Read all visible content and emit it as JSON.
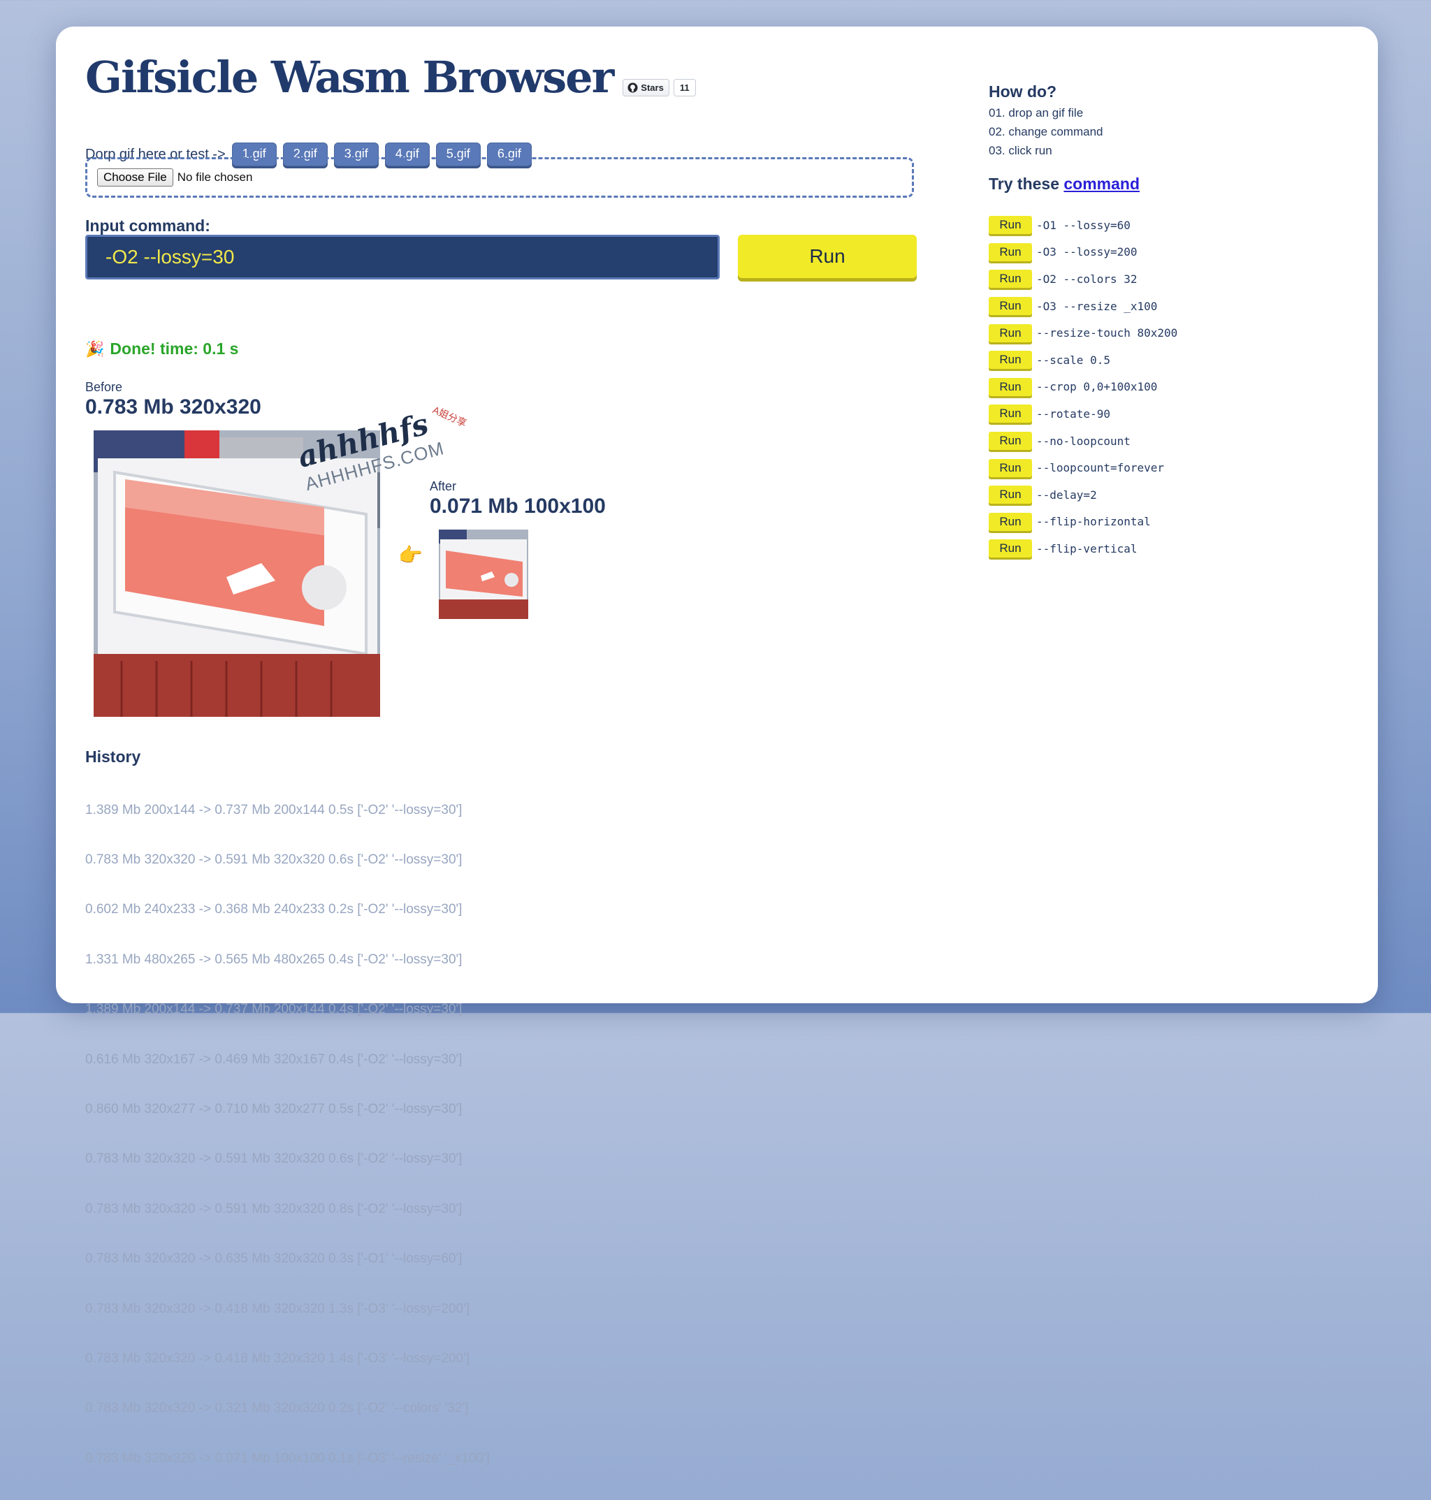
{
  "header": {
    "title": "Gifsicle Wasm Browser",
    "github_stars_label": "Stars",
    "github_stars_count": "11"
  },
  "drop": {
    "label": "Dorp gif here or test ->",
    "samples": [
      "1.gif",
      "2.gif",
      "3.gif",
      "4.gif",
      "5.gif",
      "6.gif"
    ],
    "choose_label": "Choose File",
    "file_status": "No file chosen"
  },
  "command": {
    "label": "Input command:",
    "value": "-O2 --lossy=30",
    "run_label": "Run"
  },
  "status": {
    "icon": "party-popper-icon",
    "text": "Done! time: 0.1 s"
  },
  "result": {
    "before_label": "Before",
    "before_value": "0.783 Mb 320x320",
    "after_label": "After",
    "after_value": "0.071 Mb 100x100",
    "arrow_icon": "pointing-hand-icon"
  },
  "watermark": {
    "main": "ahhhhfs",
    "sub": "AHHHHFS.COM",
    "tag": "A姐分享"
  },
  "history": {
    "title": "History",
    "items": [
      "1.389 Mb 200x144 -> 0.737 Mb 200x144 0.5s ['-O2' '--lossy=30']",
      "0.783 Mb 320x320 -> 0.591 Mb 320x320 0.6s ['-O2' '--lossy=30']",
      "0.602 Mb 240x233 -> 0.368 Mb 240x233 0.2s ['-O2' '--lossy=30']",
      "1.331 Mb 480x265 -> 0.565 Mb 480x265 0.4s ['-O2' '--lossy=30']",
      "1.389 Mb 200x144 -> 0.737 Mb 200x144 0.4s ['-O2' '--lossy=30']",
      "0.616 Mb 320x167 -> 0.469 Mb 320x167 0.4s ['-O2' '--lossy=30']",
      "0.860 Mb 320x277 -> 0.710 Mb 320x277 0.5s ['-O2' '--lossy=30']",
      "0.783 Mb 320x320 -> 0.591 Mb 320x320 0.6s ['-O2' '--lossy=30']",
      "0.783 Mb 320x320 -> 0.591 Mb 320x320 0.8s ['-O2' '--lossy=30']",
      "0.783 Mb 320x320 -> 0.635 Mb 320x320 0.3s ['-O1' '--lossy=60']",
      "0.783 Mb 320x320 -> 0.418 Mb 320x320 1.3s ['-O3' '--lossy=200']",
      "0.783 Mb 320x320 -> 0.418 Mb 320x320 1.4s ['-O3' '--lossy=200']",
      "0.783 Mb 320x320 -> 0.321 Mb 320x320 0.2s ['-O2' '--colors' '32']",
      "0.783 Mb 320x320 -> 0.071 Mb 100x100 0.1s ['-O3' '--resize' '_x100']"
    ]
  },
  "help": {
    "title": "How do?",
    "steps": [
      "01. drop an gif file",
      "02. change command",
      "03. click run"
    ],
    "try_prefix": "Try these",
    "try_link": "command",
    "run_label": "Run",
    "commands": [
      "-O1 --lossy=60",
      "-O3 --lossy=200",
      "-O2 --colors 32",
      "-O3 --resize _x100",
      "--resize-touch 80x200",
      "--scale 0.5",
      "--crop 0,0+100x100",
      "--rotate-90",
      "--no-loopcount",
      "--loopcount=forever",
      "--delay=2",
      "--flip-horizontal",
      "--flip-vertical"
    ]
  },
  "colors": {
    "accent": "#5a79b8",
    "run_yellow": "#f1ea27",
    "input_bg": "#253f6e",
    "success": "#2aa52a",
    "title": "#213a6c"
  }
}
